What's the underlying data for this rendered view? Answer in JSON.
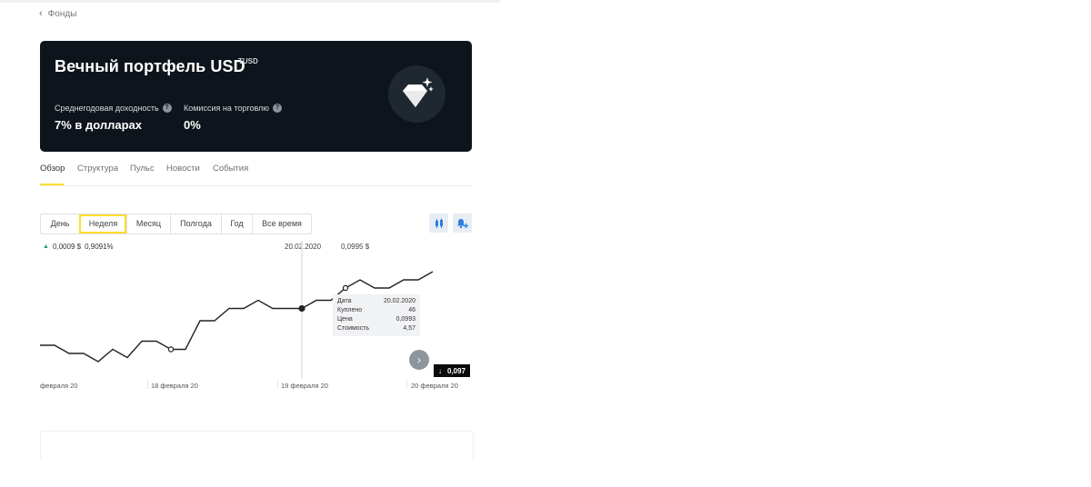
{
  "nav": {
    "back_label": "Фонды"
  },
  "fund": {
    "title": "Вечный портфель USD",
    "ticker": "TUSD",
    "stats": [
      {
        "label": "Среднегодовая доходность",
        "value": "7% в долларах"
      },
      {
        "label": "Комиссия на торговлю",
        "value": "0%"
      }
    ],
    "badge_icon": "diamond-sparkle-icon"
  },
  "tabs": [
    "Обзор",
    "Структура",
    "Пульс",
    "Новости",
    "События"
  ],
  "active_tab": "Обзор",
  "periods": [
    "День",
    "Неделя",
    "Месяц",
    "Полгода",
    "Год",
    "Все время"
  ],
  "active_period": "Неделя",
  "chart_tools": {
    "compare_icon": "compare-icon",
    "alert_icon": "bell-plus-icon"
  },
  "chart_header": {
    "change_abs": "0,0009 $",
    "change_pct": "0,9091%",
    "cursor_date": "20.02.2020",
    "cursor_price": "0,0995 $"
  },
  "tooltip": {
    "rows": [
      {
        "label": "Дата",
        "value": "20.02.2020"
      },
      {
        "label": "Куплено",
        "value": "46"
      },
      {
        "label": "Цена",
        "value": "0,0993"
      },
      {
        "label": "Стоимость",
        "value": "4,57"
      }
    ]
  },
  "last_price": "0,097",
  "colors": {
    "accent": "#ffdd2d",
    "hero_bg": "#0e141b",
    "up": "#1aa35b",
    "tool_blue": "#2f7de1"
  },
  "chart_data": {
    "type": "line",
    "x_labels": [
      "февраля 20",
      "18 февраля 20",
      "19 февраля 20",
      "20 февраля 20"
    ],
    "grid": false,
    "series": [
      {
        "values": [
          0.098,
          0.098,
          0.0978,
          0.0978,
          0.0976,
          0.0979,
          0.0977,
          0.0981,
          0.0981,
          0.0979,
          0.0979,
          0.0986,
          0.0986,
          0.0989,
          0.0989,
          0.0991,
          0.0989,
          0.0989,
          0.0989,
          0.0991,
          0.0991,
          0.0994,
          0.0996,
          0.0994,
          0.0994,
          0.0996,
          0.0996,
          0.0998
        ]
      }
    ],
    "markers": [
      {
        "index": 9,
        "kind": "buy-open"
      },
      {
        "index": 18,
        "kind": "cursor-filled"
      },
      {
        "index": 21,
        "kind": "buy-open"
      }
    ]
  }
}
